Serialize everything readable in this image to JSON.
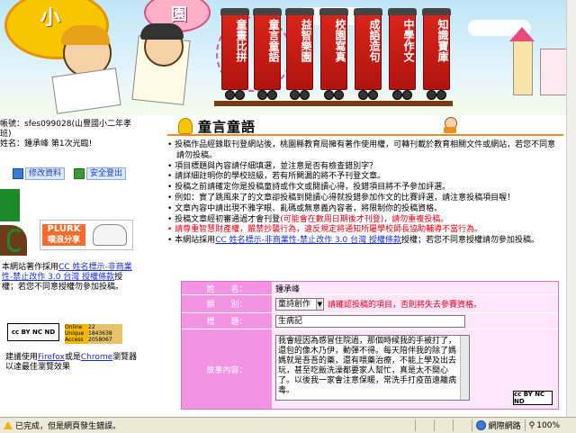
{
  "banner": {
    "logo_visible_chars": [
      "小",
      "園"
    ],
    "train_cars": [
      "童畫比拼",
      "童言童語",
      "益智樂園",
      "校園寫真",
      "成語造句",
      "中學作文",
      "知識寶庫"
    ]
  },
  "left": {
    "account_line": "帳號：sfes099028(山豐國小二年孝班)",
    "name_line": "姓名：鍾承峰 第1次光臨!",
    "edit_profile": "修改資料",
    "logout": "安全登出",
    "plurk_label": "PLURK",
    "plurk_sub": "噗浪分享",
    "license_lines": [
      "本網站著作採用",
      "CC 姓名標示-非商業性-禁止改作 3.0 台灣 授權條款",
      "授權；若您不同意授權勿參加投稿。"
    ],
    "license_prefix": "本網站著作採用",
    "license_link": "CC 姓名標示-非商業性-禁止改作 3.0 台灣 授權條款",
    "license_suffix": "授權；若您不同意授權勿參加投稿。",
    "cc_badge": "cc BY NC ND",
    "online_label": "Online",
    "unique_label": "Unique",
    "access_label": "Access",
    "online_value": "22",
    "unique_value": "1843638",
    "access_value": "2058067",
    "browser_prefix": "建議使用",
    "firefox": "Firefox",
    "or_text": "或是",
    "chrome": "Chrome",
    "browser_suffix": "瀏覽器",
    "browser_line2": "以達最佳瀏覽效果"
  },
  "content": {
    "title": "童言童語",
    "rules": [
      {
        "text": "投稿作品經錄取刊登網站後，桃園縣教育局擁有著作使用權，可轉刊載於教育相關文件或網站，若您不同意請勿投稿。",
        "red": false
      },
      {
        "text": "項目標題與內容請仔細填選，並注意是否有檢查錯別字？",
        "red": false
      },
      {
        "text": "請詳細註明你的學校班級，若有所闕漏的將不予刊登文章。",
        "red": false
      },
      {
        "text": "投稿之前請確定你是投稿童詩或作文或閱讀心得，投錯項目將不予參加評選。",
        "red": false
      },
      {
        "text": "例如：實了跳風來了的文章卻投稿到閱讀心得就投錯參加作文的比賽評選，請注意投稿項目喔！",
        "red": false
      },
      {
        "text": "文章內容中請出現不雅字眼、亂碼或無意義內容者，將限制你的投稿資格。",
        "red": false
      },
      {
        "text": "投稿文章經初審通過才會刊登",
        "red_part": "(可能會在數周日期後才刊登)，請勿重複投稿。",
        "red": false
      },
      {
        "text": "請尊重智慧財產權，嚴禁抄襲行為，違反規定將通知所屬學校師長協助輔導不當行為。",
        "red": true
      },
      {
        "text": "本網站採用",
        "link": "CC 姓名標示-非商業性-禁止改作 3.0 台灣 授權條款",
        "tail": "授權；若您不同意授權請勿參加投稿。",
        "red": false
      }
    ]
  },
  "form": {
    "author_label": "姓　　名：",
    "author_value": "鍾承峰",
    "category_label": "類　　別：",
    "category_value": "童詩創作",
    "category_hint": "請確認投稿的項目，否則將失去參賽資格。",
    "title_label": "標　　題：",
    "title_value": "生病記",
    "content_label": "故事內容：",
    "content_value": "我會經因為感冒住院過，那個時候我的手被打了，還包的像木乃伊，動彈不得。每天陪伴我的除了媽媽就是吾吾的藥，還有喂藥治療，不能上學及出去玩，甚至吃飯洗澡都要家人幫忙，真是太不開心了。以後我一家會注意保暖，常洗手打疫苗遠離病毒。"
  },
  "statusbar": {
    "left": "已完成，但是網頁發生錯誤。",
    "zone": "網際網路",
    "zoom": "100%"
  }
}
